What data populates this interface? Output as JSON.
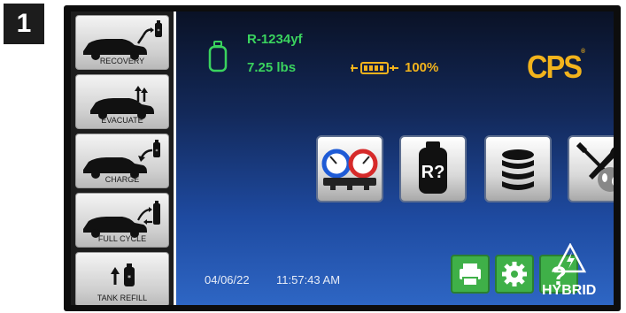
{
  "step_badge": "1",
  "sidebar": {
    "items": [
      {
        "label": "RECOVERY",
        "icon": "car-recovery-icon"
      },
      {
        "label": "EVACUATE",
        "icon": "car-evacuate-icon"
      },
      {
        "label": "CHARGE",
        "icon": "car-charge-icon"
      },
      {
        "label": "FULL CYCLE",
        "icon": "car-full-cycle-icon"
      },
      {
        "label": "TANK REFILL",
        "icon": "tank-refill-icon"
      }
    ]
  },
  "status": {
    "refrigerant": "R-1234yf",
    "tank_weight": "7.25 lbs",
    "battery_level": "100%"
  },
  "logo": {
    "text": "CPS",
    "reg": "®"
  },
  "app_buttons": [
    {
      "name": "gauges",
      "icon": "pressure-gauges-icon"
    },
    {
      "name": "refrigerant-identifier",
      "icon": "refrigerant-tank-question-icon",
      "text": "R?"
    },
    {
      "name": "database",
      "icon": "database-icon"
    },
    {
      "name": "tools",
      "icon": "tools-wrench-screwdriver-icon"
    }
  ],
  "footer": {
    "date": "04/06/22",
    "time": "11:57:43 AM",
    "help_symbol": "?",
    "hybrid_label": "HYBRID"
  },
  "colors": {
    "status_green": "#3ad35e",
    "accent_yellow": "#f2b31c",
    "button_green": "#3fb048",
    "screen_blue": "#1e4aa0"
  }
}
